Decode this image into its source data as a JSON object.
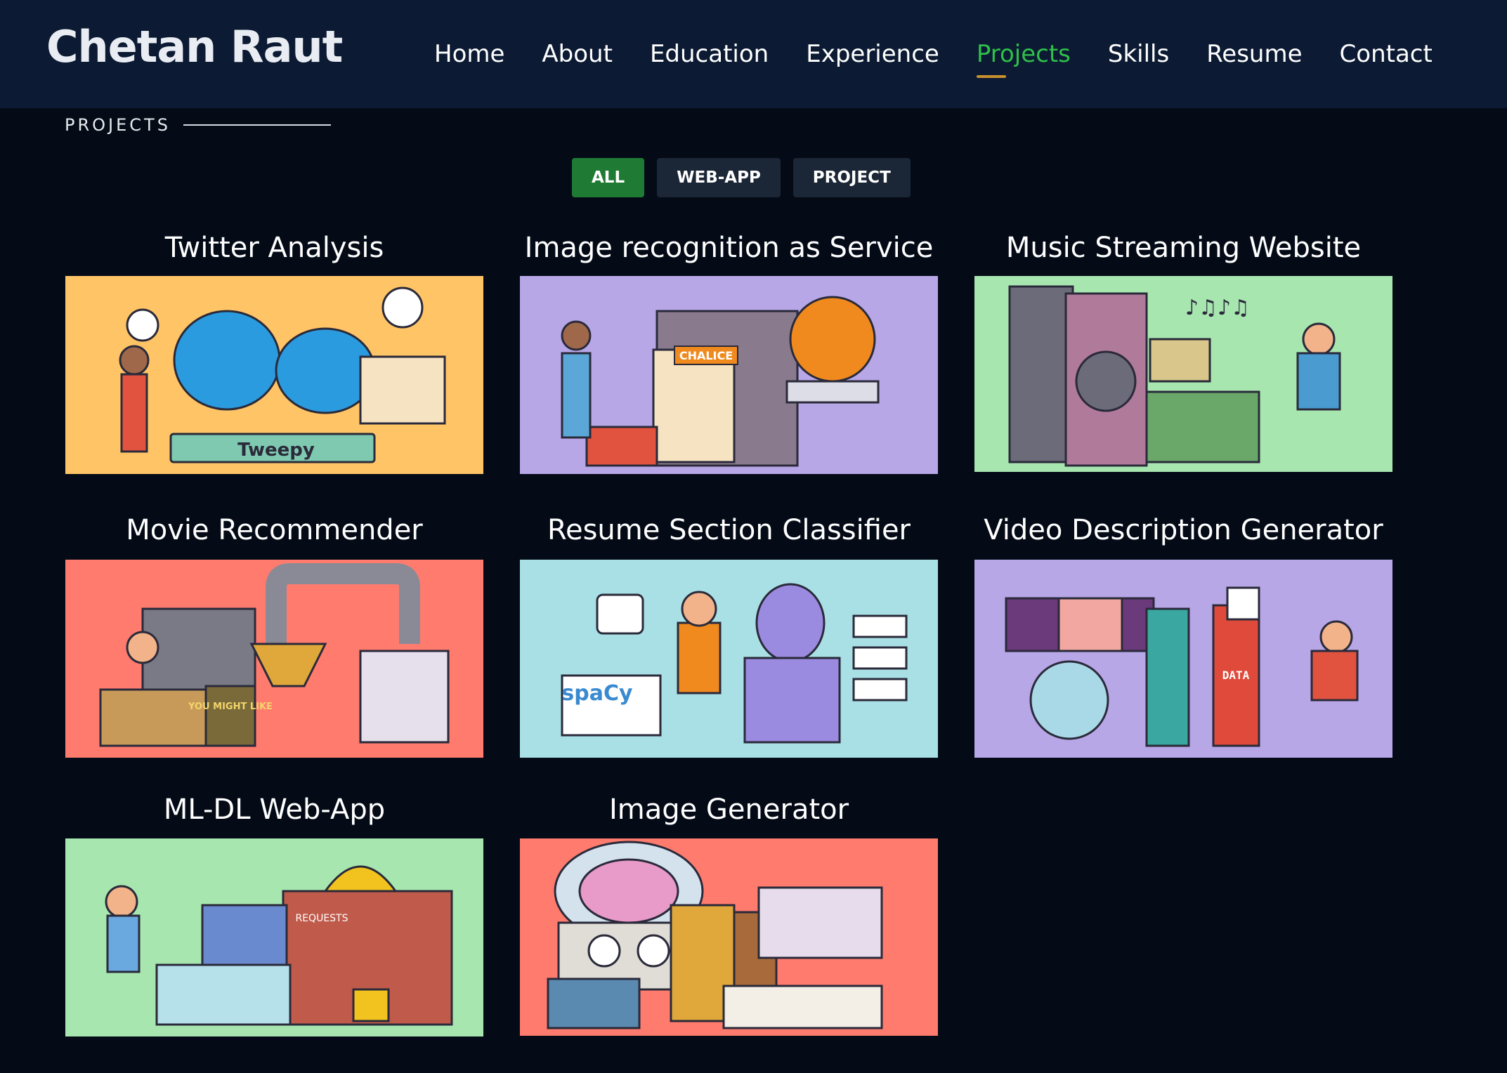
{
  "header": {
    "logo": "Chetan Raut",
    "nav": [
      {
        "label": "Home",
        "active": false
      },
      {
        "label": "About",
        "active": false
      },
      {
        "label": "Education",
        "active": false
      },
      {
        "label": "Experience",
        "active": false
      },
      {
        "label": "Projects",
        "active": true
      },
      {
        "label": "Skills",
        "active": false
      },
      {
        "label": "Resume",
        "active": false
      },
      {
        "label": "Contact",
        "active": false
      }
    ]
  },
  "section": {
    "label": "PROJECTS"
  },
  "filters": [
    {
      "label": "ALL",
      "active": true
    },
    {
      "label": "WEB-APP",
      "active": false
    },
    {
      "label": "PROJECT",
      "active": false
    }
  ],
  "projects": [
    {
      "title": "Twitter Analysis",
      "bg": "#ffc466",
      "accent": "#2b9be0",
      "text_on_image": "Tweepy"
    },
    {
      "title": "Image recognition as Service",
      "bg": "#b7a7e6",
      "accent": "#f08a1e",
      "text_on_image": "CHALICE"
    },
    {
      "title": "Music Streaming Website",
      "bg": "#a8e6b0",
      "accent": "#6b6b7a",
      "text_on_image": ""
    },
    {
      "title": "Movie Recommender",
      "bg": "#ff7b6e",
      "accent": "#8a8a96",
      "text_on_image": "YOU MIGHT LIKE"
    },
    {
      "title": "Resume Section Classifier",
      "bg": "#a9e0e6",
      "accent": "#9b8be0",
      "text_on_image": "spaCy"
    },
    {
      "title": "Video Description Generator",
      "bg": "#b7a7e6",
      "accent": "#e04a3a",
      "text_on_image": "DATA"
    },
    {
      "title": "ML-DL Web-App",
      "bg": "#a8e6b0",
      "accent": "#f2c21e",
      "text_on_image": "REQUESTS"
    },
    {
      "title": "Image Generator",
      "bg": "#ff7b6e",
      "accent": "#e89ac8",
      "text_on_image": ""
    }
  ]
}
